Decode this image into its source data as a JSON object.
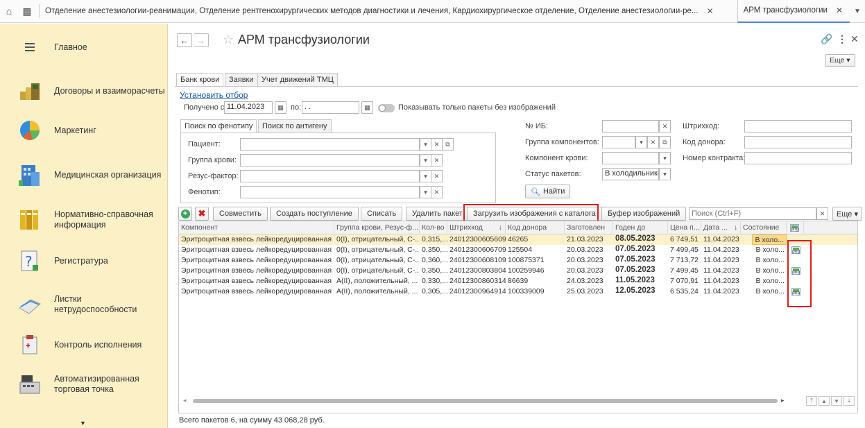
{
  "topbar": {
    "home_icon": "home-icon",
    "apps_icon": "apps-icon",
    "long_tab": "Отделение анестезиологии-реанимации, Отделение рентгенохирургических методов диагностики и лечения, Кардиохирургическое отделение, Отделение анестезиологии-ре...",
    "active_tab": "АРМ трансфузиологии"
  },
  "sidebar": {
    "items": [
      {
        "label": "Главное",
        "icon": "menu-icon"
      },
      {
        "label": "Договоры и взаиморасчеты",
        "icon": "coins-icon"
      },
      {
        "label": "Маркетинг",
        "icon": "pie-chart-icon"
      },
      {
        "label": "Медицинская организация",
        "icon": "building-icon"
      },
      {
        "label": "Нормативно-справочная информация",
        "icon": "binders-icon"
      },
      {
        "label": "Регистратура",
        "icon": "question-book-icon"
      },
      {
        "label": "Листки нетрудоспособности",
        "icon": "sick-leave-icon"
      },
      {
        "label": "Контроль исполнения",
        "icon": "clipboard-icon"
      },
      {
        "label": "Автоматизированная торговая точка",
        "icon": "cash-register-icon"
      }
    ]
  },
  "header": {
    "title": "АРМ трансфузиологии",
    "more_label": "Еще ▾"
  },
  "tabs": [
    "Банк крови",
    "Заявки",
    "Учет движений ТМЦ"
  ],
  "filter": {
    "set_filter_link": "Установить отбор",
    "received_from_label": "Получено с:",
    "received_from_value": "11.04.2023",
    "to_label": "по:",
    "to_value": ". .",
    "show_only_label": "Показывать только пакеты без изображений"
  },
  "search_panel": {
    "tabs": [
      "Поиск по фенотипу",
      "Поиск по антигену"
    ],
    "patient_label": "Пациент:",
    "blood_group_label": "Группа крови:",
    "rhesus_label": "Резус-фактор:",
    "phenotype_label": "Фенотип:"
  },
  "right_filters": {
    "ib_label": "№ ИБ:",
    "component_group_label": "Группа компонентов:",
    "blood_component_label": "Компонент крови:",
    "package_status_label": "Статус пакетов:",
    "package_status_value": "В холодильнике",
    "find_label": "Найти",
    "barcode_label": "Штрихкод:",
    "donor_code_label": "Код донора:",
    "contract_number_label": "Номер контракта:"
  },
  "toolbar": {
    "combine": "Совместить",
    "create_receipt": "Создать поступление",
    "write_off": "Списать",
    "delete_package": "Удалить пакет",
    "load_images": "Загрузить изображения с каталога",
    "image_buffer": "Буфер изображений",
    "search_placeholder": "Поиск (Ctrl+F)",
    "more": "Еще ▾"
  },
  "table": {
    "headers": [
      "Компонент",
      "Группа крови, Резус-ф...",
      "Кол-во",
      "Штрихкод",
      "↓",
      "Код донора",
      "Заготовлен",
      "Годен до",
      "Цена п...",
      "Дата ...",
      "↓",
      "Состояние"
    ],
    "rows": [
      {
        "component": "Эритроцитная взвесь лейкоредуцированная",
        "group": "0(I), отрицательный, C-...",
        "qty": "0,315,...",
        "barcode": "24012300605609",
        "donor": "46265",
        "prepared": "21.03.2023",
        "valid": "08.05.2023",
        "price": "6 749,51",
        "date": "11.04.2023",
        "state": "В холо...",
        "has_image": false
      },
      {
        "component": "Эритроцитная взвесь лейкоредуцированная",
        "group": "0(I), отрицательный, C-...",
        "qty": "0,350,...",
        "barcode": "24012300606709",
        "donor": "125504",
        "prepared": "20.03.2023",
        "valid": "07.05.2023",
        "price": "7 499,45",
        "date": "11.04.2023",
        "state": "В холо...",
        "has_image": true
      },
      {
        "component": "Эритроцитная взвесь лейкоредуцированная",
        "group": "0(I), отрицательный, C-...",
        "qty": "0,360,...",
        "barcode": "24012300608109",
        "donor": "100875371",
        "prepared": "20.03.2023",
        "valid": "07.05.2023",
        "price": "7 713,72",
        "date": "11.04.2023",
        "state": "В холо...",
        "has_image": false
      },
      {
        "component": "Эритроцитная взвесь лейкоредуцированная",
        "group": "0(I), отрицательный, C-...",
        "qty": "0,350,...",
        "barcode": "24012300803804",
        "donor": "100259946",
        "prepared": "20.03.2023",
        "valid": "07.05.2023",
        "price": "7 499,45",
        "date": "11.04.2023",
        "state": "В холо...",
        "has_image": true
      },
      {
        "component": "Эритроцитная взвесь лейкоредуцированная",
        "group": "A(II), положительный, ...",
        "qty": "0,330,...",
        "barcode": "24012300860314",
        "donor": "86639",
        "prepared": "24.03.2023",
        "valid": "11.05.2023",
        "price": "7 070,91",
        "date": "11.04.2023",
        "state": "В холо...",
        "has_image": false
      },
      {
        "component": "Эритроцитная взвесь лейкоредуцированная",
        "group": "A(II), положительный, ...",
        "qty": "0,305,...",
        "barcode": "24012300964914",
        "donor": "100339009",
        "prepared": "25.03.2023",
        "valid": "12.05.2023",
        "price": "6 535,24",
        "date": "11.04.2023",
        "state": "В холо...",
        "has_image": true
      }
    ]
  },
  "footer": "Всего пакетов 6, на сумму 43 068,28 руб.",
  "colors": {
    "sidebar_bg": "#fbf0c6",
    "selected_row": "#fbf1cb",
    "highlight_box": "#e01b1b",
    "link": "#1a55a8"
  }
}
